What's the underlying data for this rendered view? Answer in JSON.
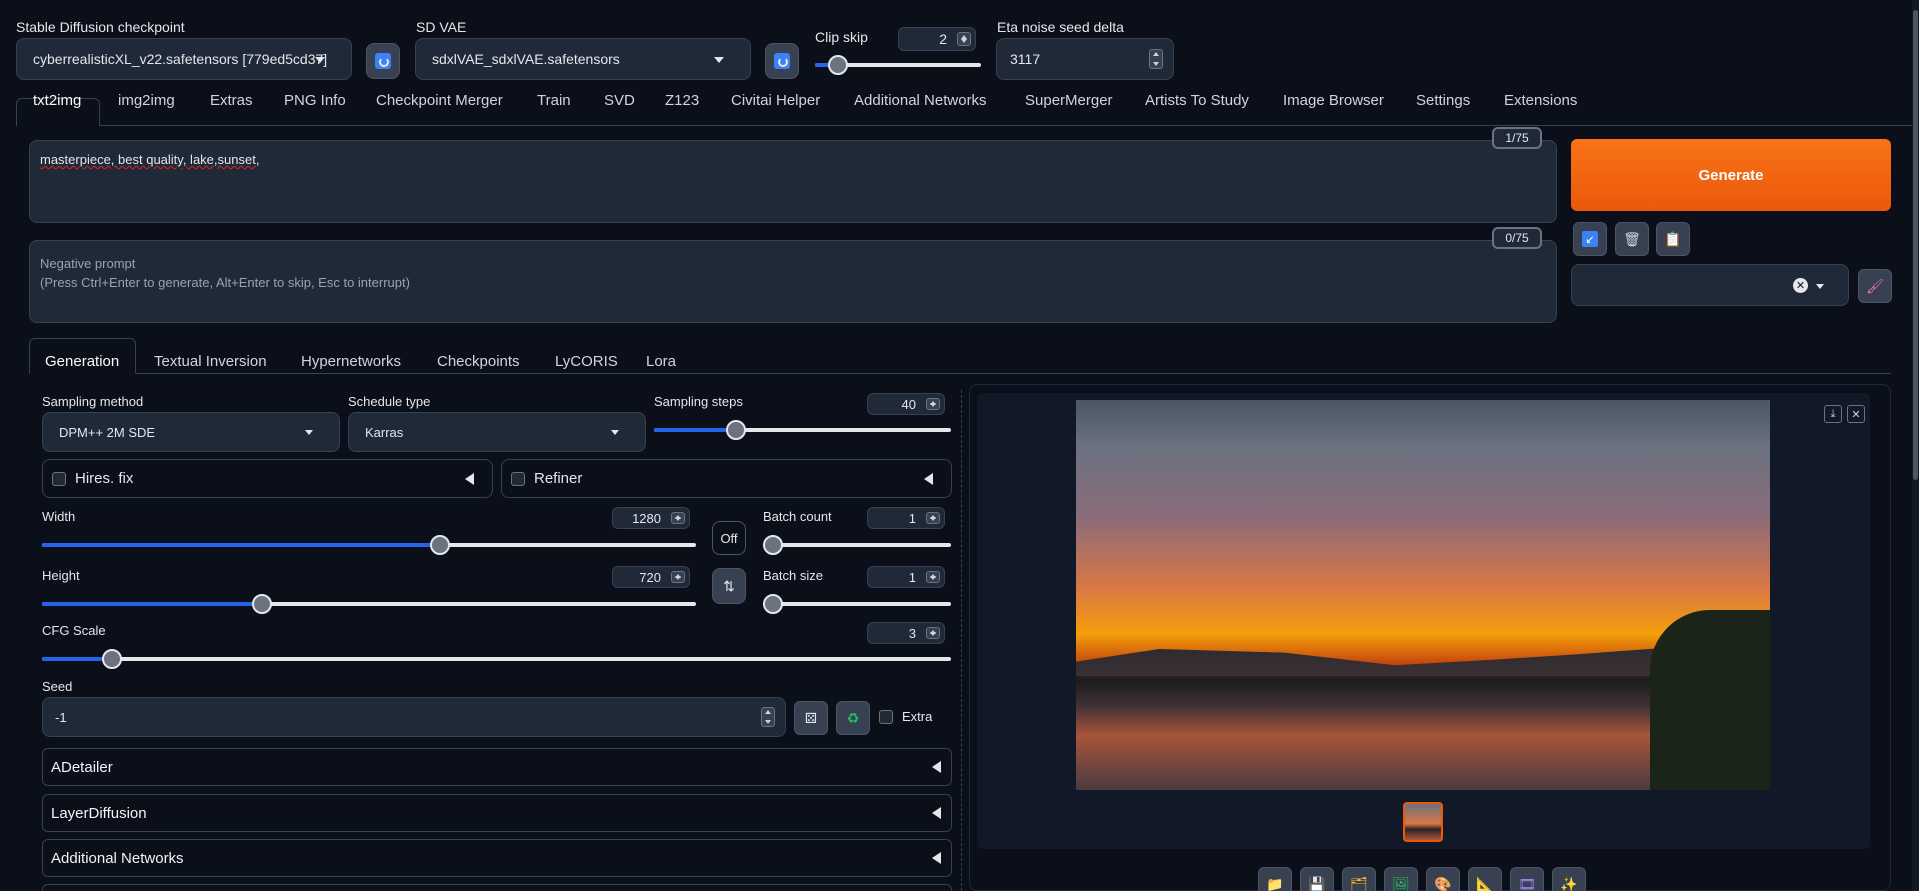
{
  "top": {
    "checkpoint_label": "Stable Diffusion checkpoint",
    "checkpoint_value": "cyberrealisticXL_v22.safetensors [779ed5cd37]",
    "vae_label": "SD VAE",
    "vae_value": "sdxlVAE_sdxlVAE.safetensors",
    "clip_label": "Clip skip",
    "clip_value": "2",
    "clip_level": 0.1,
    "eta_label": "Eta noise seed delta",
    "eta_value": "3117"
  },
  "tabs": [
    "txt2img",
    "img2img",
    "Extras",
    "PNG Info",
    "Checkpoint Merger",
    "Train",
    "SVD",
    "Z123",
    "Civitai Helper",
    "Additional Networks",
    "SuperMerger",
    "Artists To Study",
    "Image Browser",
    "Settings",
    "Extensions"
  ],
  "prompt": {
    "text": "masterpiece, best quality,   lake,sunset,",
    "counter": "1/75",
    "neg_counter": "0/75",
    "neg_placeholder_1": "Negative prompt",
    "neg_placeholder_2": "(Press Ctrl+Enter to generate, Alt+Enter to skip, Esc to interrupt)"
  },
  "generate_label": "Generate",
  "subtabs": [
    "Generation",
    "Textual Inversion",
    "Hypernetworks",
    "Checkpoints",
    "LyCORIS",
    "Lora"
  ],
  "gen": {
    "sampling_method_label": "Sampling method",
    "sampling_method_value": "DPM++ 2M SDE",
    "schedule_label": "Schedule type",
    "schedule_value": "Karras",
    "steps_label": "Sampling steps",
    "steps_value": "40",
    "hires_label": "Hires. fix",
    "refiner_label": "Refiner",
    "width_label": "Width",
    "width_value": "1280",
    "height_label": "Height",
    "height_value": "720",
    "off_label": "Off",
    "batch_count_label": "Batch count",
    "batch_count_value": "1",
    "batch_size_label": "Batch size",
    "batch_size_value": "1",
    "cfg_label": "CFG Scale",
    "cfg_value": "3",
    "seed_label": "Seed",
    "seed_value": "-1",
    "extra_label": "Extra",
    "accordions": [
      "ADetailer",
      "LayerDiffusion",
      "Additional Networks"
    ]
  },
  "colors": {
    "accent": "#ea580c",
    "slider": "#2563eb",
    "bg": "#0b0f19"
  },
  "icons": [
    "refresh-icon",
    "paint-brush-icon",
    "trash-icon",
    "clipboard-icon",
    "arrow-icon",
    "dice-icon",
    "recycle-icon",
    "swap-icon",
    "download-icon",
    "close-icon",
    "folder-icon",
    "save-icon",
    "zip-icon",
    "image-icon",
    "palette-icon",
    "ruler-icon",
    "film-icon",
    "sparkle-icon"
  ]
}
